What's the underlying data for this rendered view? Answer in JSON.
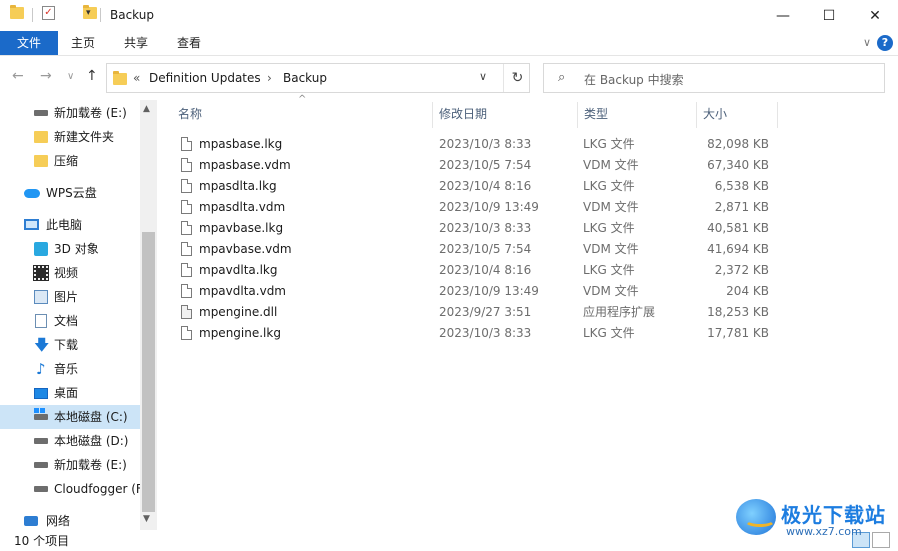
{
  "window": {
    "title": "Backup",
    "minimize_glyph": "—",
    "maximize_glyph": "☐",
    "close_glyph": "✕"
  },
  "ribbon": {
    "tabs": [
      "文件",
      "主页",
      "共享",
      "查看"
    ],
    "help_glyph": "?",
    "expand_glyph": "∨"
  },
  "nav": {
    "back_glyph": "←",
    "forward_glyph": "→",
    "recent_glyph": "∨",
    "up_glyph": "↑",
    "breadcrumb_overflow": "«",
    "breadcrumbs": [
      "Definition Updates",
      "Backup"
    ],
    "separator": "›",
    "dropdown_glyph": "∨",
    "refresh_glyph": "↻"
  },
  "search": {
    "placeholder": "在 Backup 中搜索",
    "icon": "search-icon"
  },
  "sidebar": {
    "items": [
      {
        "label": "新加载卷 (E:)",
        "icon": "drive-icon"
      },
      {
        "label": "新建文件夹",
        "icon": "folder-icon"
      },
      {
        "label": "压缩",
        "icon": "folder-icon"
      },
      {
        "label": "WPS云盘",
        "icon": "cloud-icon"
      },
      {
        "label": "此电脑",
        "icon": "computer-icon"
      },
      {
        "label": "3D 对象",
        "icon": "3d-objects-icon"
      },
      {
        "label": "视频",
        "icon": "video-icon"
      },
      {
        "label": "图片",
        "icon": "pictures-icon"
      },
      {
        "label": "文档",
        "icon": "documents-icon"
      },
      {
        "label": "下载",
        "icon": "download-icon"
      },
      {
        "label": "音乐",
        "icon": "music-icon"
      },
      {
        "label": "桌面",
        "icon": "desktop-icon"
      },
      {
        "label": "本地磁盘 (C:)",
        "icon": "local-disk-icon",
        "selected": true
      },
      {
        "label": "本地磁盘 (D:)",
        "icon": "drive-icon"
      },
      {
        "label": "新加载卷 (E:)",
        "icon": "drive-icon"
      },
      {
        "label": "Cloudfogger (F",
        "icon": "drive-icon"
      },
      {
        "label": "网络",
        "icon": "network-icon"
      }
    ],
    "scroll_up_glyph": "▲",
    "scroll_down_glyph": "▼"
  },
  "columns": {
    "name": "名称",
    "date": "修改日期",
    "type": "类型",
    "size": "大小",
    "sort_glyph": "^"
  },
  "files": [
    {
      "name": "mpasbase.lkg",
      "date": "2023/10/3 8:33",
      "type": "LKG 文件",
      "size": "82,098 KB"
    },
    {
      "name": "mpasbase.vdm",
      "date": "2023/10/5 7:54",
      "type": "VDM 文件",
      "size": "67,340 KB"
    },
    {
      "name": "mpasdlta.lkg",
      "date": "2023/10/4 8:16",
      "type": "LKG 文件",
      "size": "6,538 KB"
    },
    {
      "name": "mpasdlta.vdm",
      "date": "2023/10/9 13:49",
      "type": "VDM 文件",
      "size": "2,871 KB"
    },
    {
      "name": "mpavbase.lkg",
      "date": "2023/10/3 8:33",
      "type": "LKG 文件",
      "size": "40,581 KB"
    },
    {
      "name": "mpavbase.vdm",
      "date": "2023/10/5 7:54",
      "type": "VDM 文件",
      "size": "41,694 KB"
    },
    {
      "name": "mpavdlta.lkg",
      "date": "2023/10/4 8:16",
      "type": "LKG 文件",
      "size": "2,372 KB"
    },
    {
      "name": "mpavdlta.vdm",
      "date": "2023/10/9 13:49",
      "type": "VDM 文件",
      "size": "204 KB"
    },
    {
      "name": "mpengine.dll",
      "date": "2023/9/27 3:51",
      "type": "应用程序扩展",
      "size": "18,253 KB"
    },
    {
      "name": "mpengine.lkg",
      "date": "2023/10/3 8:33",
      "type": "LKG 文件",
      "size": "17,781 KB"
    }
  ],
  "status": {
    "item_count": "10 个项目"
  },
  "watermark": {
    "title": "极光下载站",
    "url": "www.xz7.com"
  }
}
